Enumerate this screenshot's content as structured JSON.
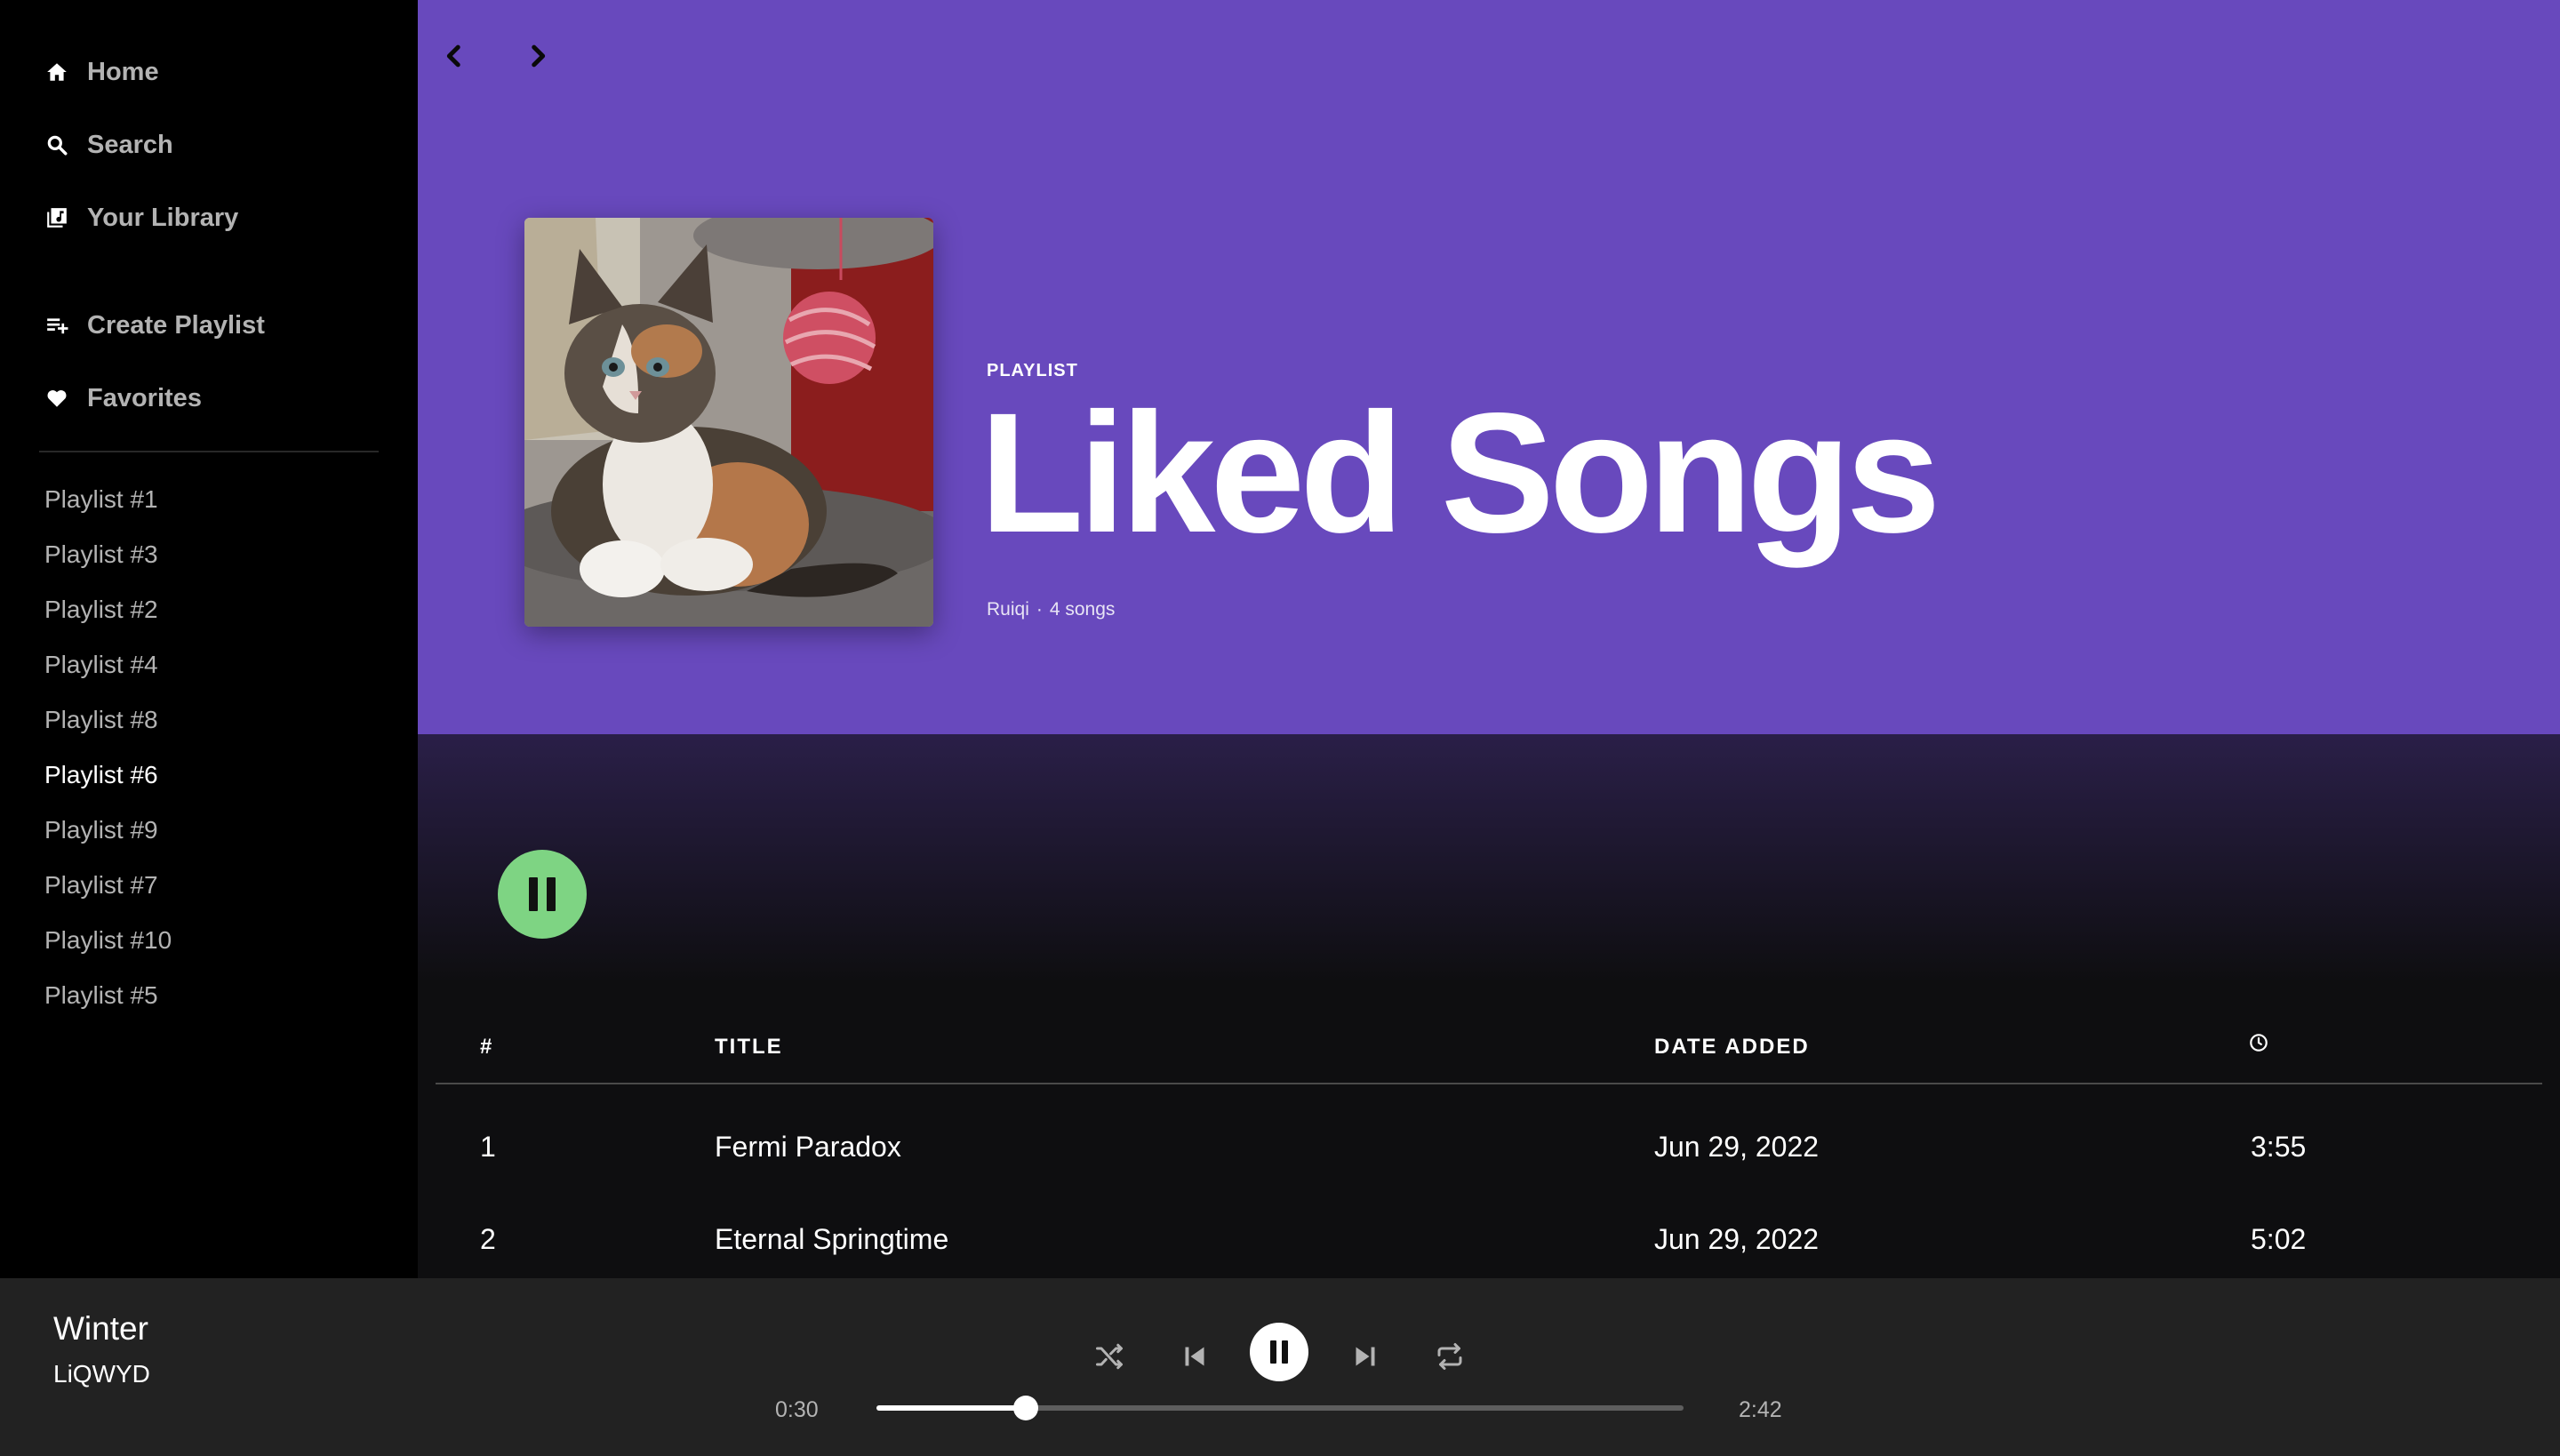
{
  "sidebar": {
    "nav": [
      {
        "label": "Home",
        "icon": "home-icon"
      },
      {
        "label": "Search",
        "icon": "search-icon"
      },
      {
        "label": "Your Library",
        "icon": "library-icon"
      }
    ],
    "actions": [
      {
        "label": "Create Playlist",
        "icon": "create-playlist-icon"
      },
      {
        "label": "Favorites",
        "icon": "heart-icon"
      }
    ],
    "playlists": [
      "Playlist #1",
      "Playlist #3",
      "Playlist #2",
      "Playlist #4",
      "Playlist #8",
      "Playlist #6",
      "Playlist #9",
      "Playlist #7",
      "Playlist #10",
      "Playlist #5"
    ],
    "active_playlist": "Playlist #6"
  },
  "header": {
    "back_icon": "chevron-left-icon",
    "forward_icon": "chevron-right-icon",
    "type": "PLAYLIST",
    "title": "Liked Songs",
    "owner": "Ruiqi",
    "separator": "·",
    "song_count": "4 songs",
    "cover_icon": "kitten-cover-image"
  },
  "table": {
    "columns": {
      "number": "#",
      "title": "TITLE",
      "date_added": "DATE ADDED",
      "duration_icon": "clock-icon"
    },
    "rows": [
      {
        "number": "1",
        "title": "Fermi Paradox",
        "date_added": "Jun 29, 2022",
        "duration": "3:55"
      },
      {
        "number": "2",
        "title": "Eternal Springtime",
        "date_added": "Jun 29, 2022",
        "duration": "5:02"
      }
    ]
  },
  "player": {
    "title": "Winter",
    "artist": "LiQWYD",
    "elapsed": "0:30",
    "total": "2:42",
    "progress_fraction": 0.185,
    "icons": [
      "shuffle-icon",
      "previous-icon",
      "pause-icon",
      "next-icon",
      "repeat-icon"
    ]
  },
  "colors": {
    "hero": "#6849bd",
    "accent": "#7ed483",
    "background": "#121212",
    "player": "#222222"
  }
}
